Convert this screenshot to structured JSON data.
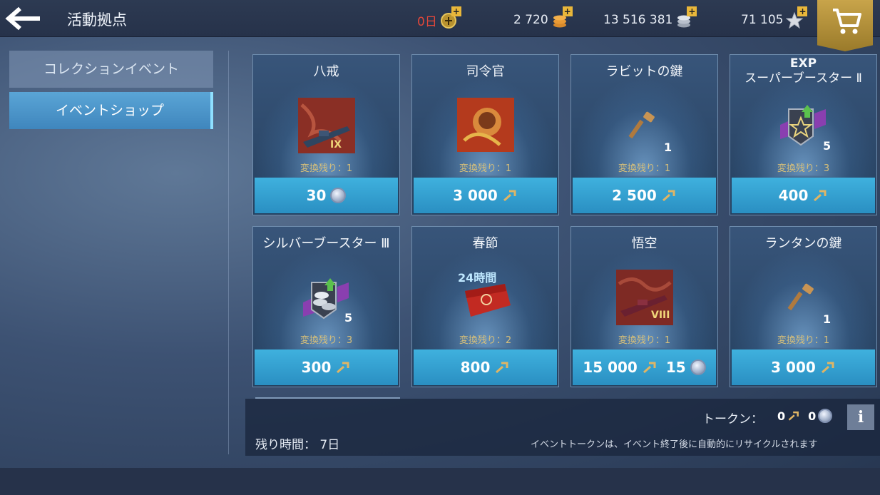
{
  "header": {
    "title": "活動拠点",
    "days_premium": "0日",
    "doubloons": "2 720",
    "credits": "13 516 381",
    "free_xp": "71 105"
  },
  "sidebar": {
    "tabs": [
      {
        "label": "コレクションイベント"
      },
      {
        "label": "イベントショップ"
      }
    ]
  },
  "shop": {
    "items": [
      {
        "name": "八戒",
        "tier": "IX",
        "exchange": "変換残り：1",
        "price": "30",
        "currency": "coin"
      },
      {
        "name": "司令官",
        "exchange": "変換残り：1",
        "price": "3 000",
        "currency": "token"
      },
      {
        "name": "ラビットの鍵",
        "qty": "1",
        "exchange": "変換残り：1",
        "price": "2 500",
        "currency": "token"
      },
      {
        "name_line1": "EXP",
        "name_line2": "スーパーブースター Ⅱ",
        "qty": "5",
        "exchange": "変換残り：3",
        "price": "400",
        "currency": "token"
      },
      {
        "name": "シルバーブースター Ⅲ",
        "qty": "5",
        "exchange": "変換残り：3",
        "price": "300",
        "currency": "token"
      },
      {
        "name": "春節",
        "badge": "24時間",
        "exchange": "変換残り：2",
        "price": "800",
        "currency": "token"
      },
      {
        "name": "悟空",
        "tier": "VIII",
        "exchange": "変換残り：1",
        "price": "15 000",
        "price2": "15",
        "currency": "token+coin"
      },
      {
        "name": "ランタンの鍵",
        "qty": "1",
        "exchange": "変換残り：1",
        "price": "3 000",
        "currency": "token"
      }
    ]
  },
  "footer": {
    "remaining_time": "残り時間：  7日",
    "tokens_label": "トークン：",
    "tokens_value": "0",
    "coins_value": "0",
    "recycle_note": "イベントトークンは、イベント終了後に自動的にリサイクルされます"
  }
}
